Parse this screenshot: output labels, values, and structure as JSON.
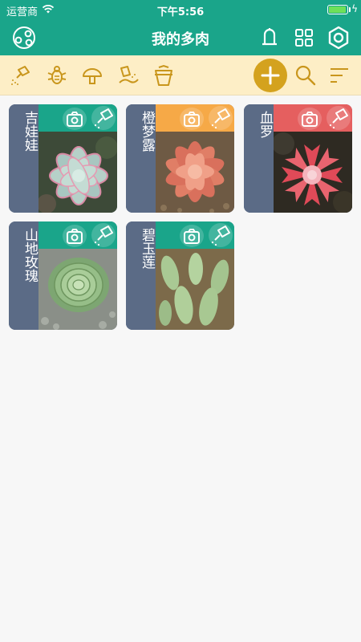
{
  "status_bar": {
    "carrier": "运营商",
    "time": "下午5:56",
    "battery_level": 1.0
  },
  "nav": {
    "title": "我的多肉",
    "icons": [
      "plant-graph-icon",
      "bell-icon",
      "grid-icon",
      "gear-icon"
    ]
  },
  "toolbar": {
    "icons": [
      "watering-can-icon",
      "bug-icon",
      "fungus-icon",
      "fertilize-icon",
      "repot-icon",
      "add-icon",
      "search-icon",
      "sort-icon"
    ]
  },
  "colors": {
    "primary": "#1aa58a",
    "toolbar_bg": "#fdeec6",
    "accent": "#d4a21e",
    "card_side": "#5b6b86",
    "header_green": "#1aa58a",
    "header_orange": "#f6a947",
    "header_red": "#e55f5f"
  },
  "plants": [
    {
      "name": "吉娃娃",
      "header_color": "#1aa58a",
      "photo": "pastel-rosette"
    },
    {
      "name": "橙梦露",
      "header_color": "#f6a947",
      "photo": "orange-rosette"
    },
    {
      "name": "血罗",
      "header_color": "#e55f5f",
      "photo": "red-rosette"
    },
    {
      "name": "山地玫瑰",
      "header_color": "#1aa58a",
      "photo": "green-rose"
    },
    {
      "name": "碧玉莲",
      "header_color": "#1aa58a",
      "photo": "green-leaves"
    }
  ]
}
